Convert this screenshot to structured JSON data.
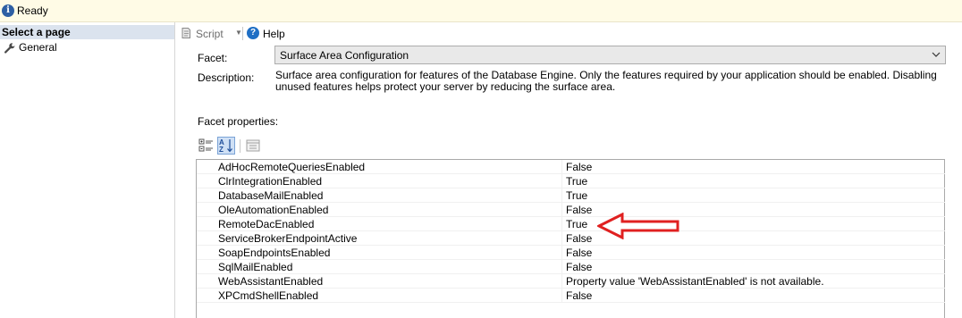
{
  "status": {
    "text": "Ready",
    "icon": "info-icon"
  },
  "sidebar": {
    "header": "Select a page",
    "items": [
      {
        "label": "General",
        "icon": "wrench-icon"
      }
    ]
  },
  "toolbar": {
    "script_label": "Script",
    "help_label": "Help"
  },
  "facet": {
    "label": "Facet:",
    "value": "Surface Area Configuration"
  },
  "description": {
    "label": "Description:",
    "text": "Surface area configuration for features of the Database Engine. Only the features required by your application should be enabled. Disabling unused features helps protect your server by reducing the surface area."
  },
  "facet_properties": {
    "label": "Facet properties:",
    "rows": [
      {
        "name": "AdHocRemoteQueriesEnabled",
        "value": "False"
      },
      {
        "name": "ClrIntegrationEnabled",
        "value": "True"
      },
      {
        "name": "DatabaseMailEnabled",
        "value": "True"
      },
      {
        "name": "OleAutomationEnabled",
        "value": "False"
      },
      {
        "name": "RemoteDacEnabled",
        "value": "True"
      },
      {
        "name": "ServiceBrokerEndpointActive",
        "value": "False"
      },
      {
        "name": "SoapEndpointsEnabled",
        "value": "False"
      },
      {
        "name": "SqlMailEnabled",
        "value": "False"
      },
      {
        "name": "WebAssistantEnabled",
        "value": "Property value 'WebAssistantEnabled' is not available."
      },
      {
        "name": "XPCmdShellEnabled",
        "value": "False"
      }
    ]
  },
  "colors": {
    "annotation_arrow": "#e02020",
    "status_bar_bg": "#fffbe6",
    "sidebar_header_bg": "#dbe3ee"
  }
}
